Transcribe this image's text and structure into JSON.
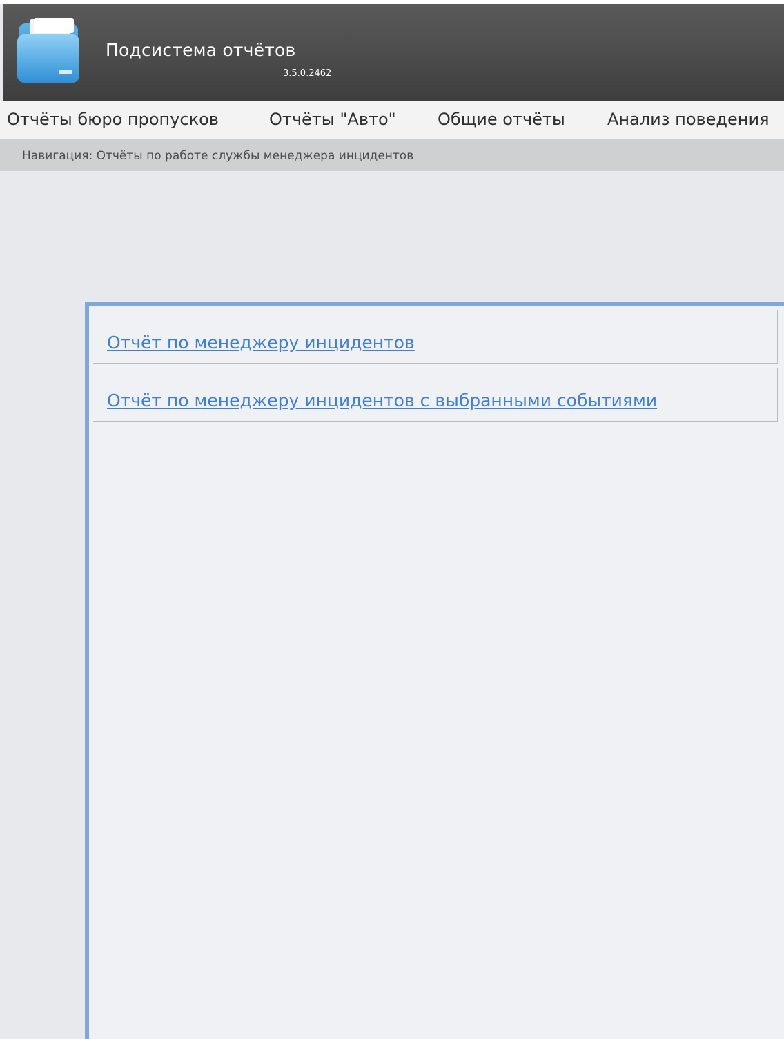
{
  "app": {
    "title": "Подсистема отчётов",
    "version": "3.5.0.2462"
  },
  "menu": {
    "items": [
      {
        "label": "Отчёты бюро пропусков"
      },
      {
        "label": "Отчёты \"Авто\""
      },
      {
        "label": "Общие отчёты"
      },
      {
        "label": "Анализ поведения"
      }
    ]
  },
  "breadcrumb": {
    "text": "Навигация: Отчёты по работе службы менеджера инцидентов"
  },
  "reports": {
    "items": [
      {
        "label": "Отчёт по менеджеру инцидентов"
      },
      {
        "label": "Отчёт по менеджеру инцидентов с выбранными событиями"
      }
    ]
  },
  "colors": {
    "header": "#4a4a4a",
    "link": "#3f7ed6",
    "panel_border": "#7ea7dc",
    "background": "#e8e9ec"
  }
}
